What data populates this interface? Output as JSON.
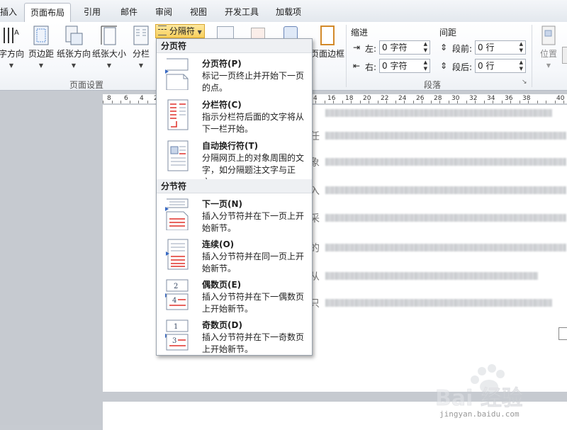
{
  "tabs": [
    {
      "id": "insert",
      "label": "插入"
    },
    {
      "id": "page_layout",
      "label": "页面布局",
      "active": true
    },
    {
      "id": "references",
      "label": "引用"
    },
    {
      "id": "mailings",
      "label": "邮件"
    },
    {
      "id": "review",
      "label": "审阅"
    },
    {
      "id": "view",
      "label": "视图"
    },
    {
      "id": "developer",
      "label": "开发工具"
    },
    {
      "id": "addins",
      "label": "加载项"
    }
  ],
  "ribbon": {
    "page_setup": {
      "text_direction": "字方向",
      "margins": "页边距",
      "orientation": "纸张方向",
      "size": "纸张大小",
      "columns": "分栏",
      "group_label": "页面设置"
    },
    "breaks_label": "分隔符",
    "page_borders_label": "页面边框",
    "paragraph": {
      "indent_header": "缩进",
      "spacing_header": "间距",
      "left_label": "左:",
      "left_value": "0 字符",
      "right_label": "右:",
      "right_value": "0 字符",
      "before_label": "段前:",
      "before_value": "0 行",
      "after_label": "段后:",
      "after_value": "0 行",
      "group_label": "段落"
    },
    "arrange": {
      "position_label": "位置"
    }
  },
  "ruler": {
    "left_numbers": [
      "8",
      "6",
      "4",
      "2"
    ],
    "right_numbers": [
      "4",
      "16",
      "18",
      "20",
      "22",
      "24",
      "26",
      "28",
      "30",
      "32",
      "34",
      "36",
      "38",
      "40"
    ]
  },
  "document_lines": [
    {
      "char": "任"
    },
    {
      "char": "象"
    },
    {
      "char": "入"
    },
    {
      "char": "采"
    },
    {
      "char": "的"
    },
    {
      "char": "从"
    },
    {
      "char": "只"
    }
  ],
  "dropdown": {
    "section_page_breaks": "分页符",
    "section_section_breaks": "分节符",
    "items": [
      {
        "title": "分页符(P)",
        "desc": "标记一页终止并开始下一页的点。"
      },
      {
        "title": "分栏符(C)",
        "desc": "指示分栏符后面的文字将从下一栏开始。"
      },
      {
        "title": "自动换行符(T)",
        "desc": "分隔网页上的对象周围的文字，如分隔题注文字与正文。"
      },
      {
        "title": "下一页(N)",
        "desc": "插入分节符并在下一页上开始新节。"
      },
      {
        "title": "连续(O)",
        "desc": "插入分节符并在同一页上开始新节。"
      },
      {
        "title": "偶数页(E)",
        "desc": "插入分节符并在下一偶数页上开始新节。"
      },
      {
        "title": "奇数页(D)",
        "desc": "插入分节符并在下一奇数页上开始新节。"
      }
    ]
  },
  "watermark": {
    "text": "Bai 经验",
    "url": "jingyan.baidu.com"
  },
  "colors": {
    "breaks_highlight": "#f8cf5b",
    "accent_red": "#e0302a",
    "accent_blue": "#3a6bc4"
  }
}
